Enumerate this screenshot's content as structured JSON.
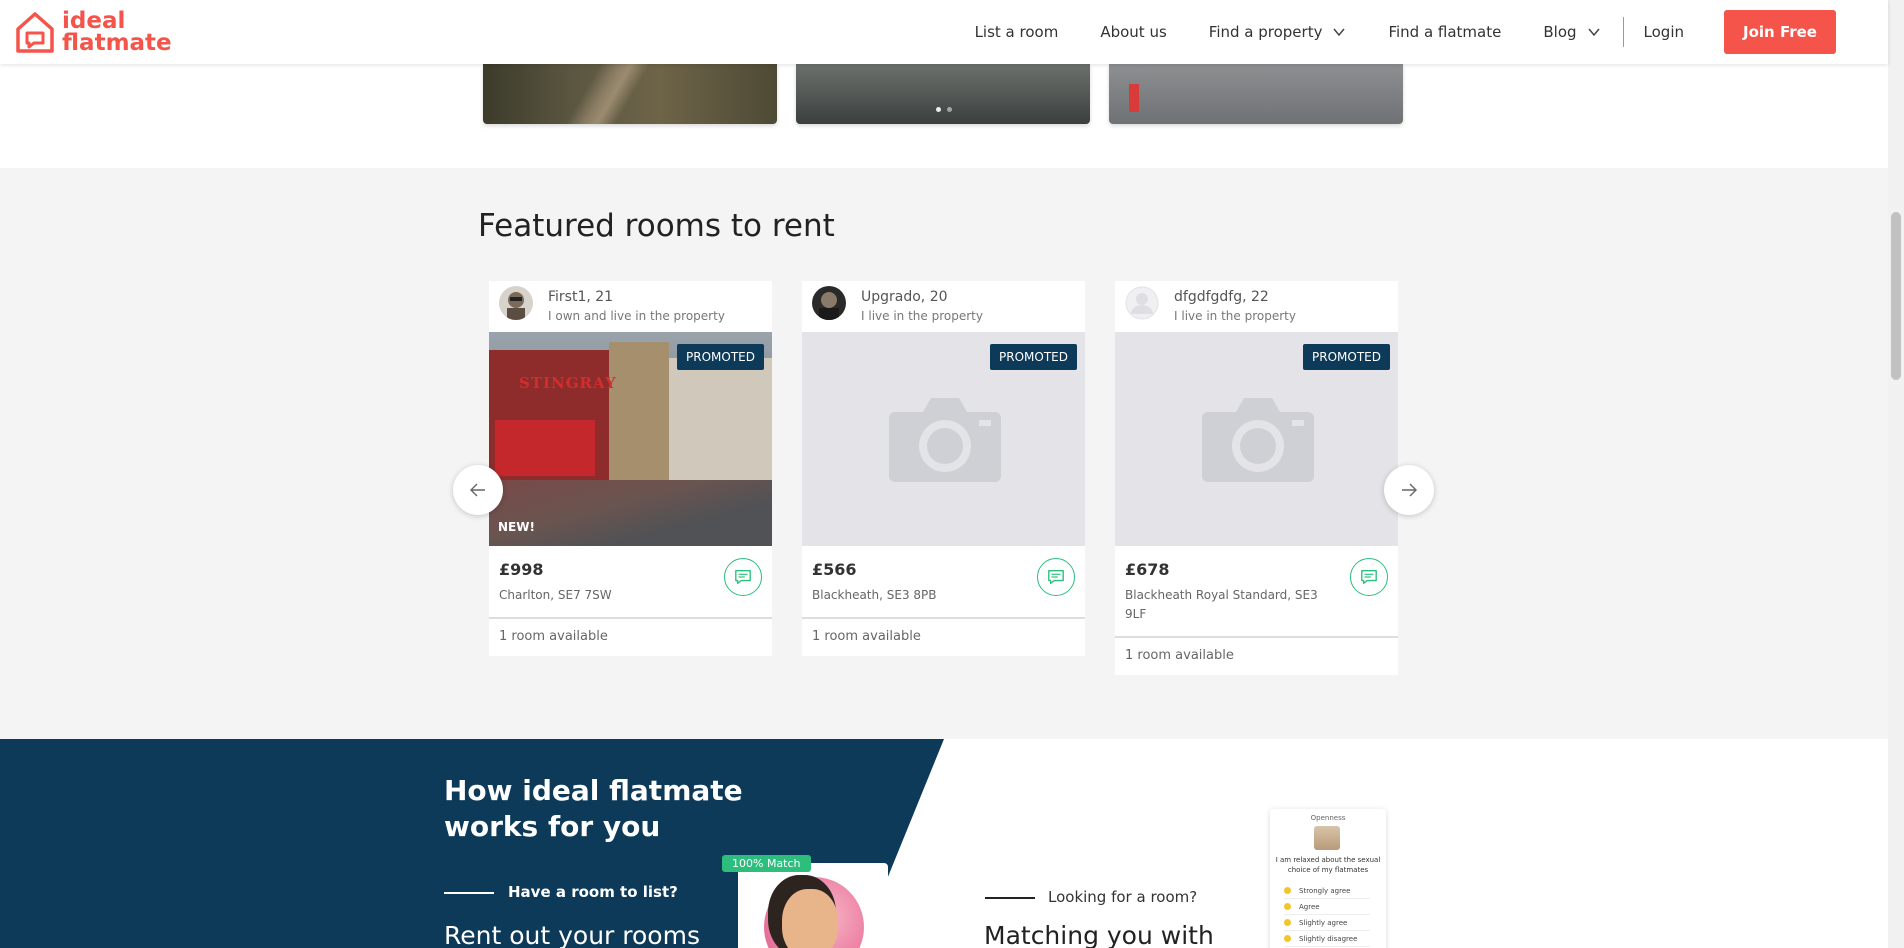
{
  "header": {
    "logo_line1": "ideal",
    "logo_line2": "flatmate",
    "nav": [
      {
        "label": "List a room"
      },
      {
        "label": "About us"
      },
      {
        "label": "Find a property",
        "dropdown": true
      },
      {
        "label": "Find a flatmate"
      },
      {
        "label": "Blog",
        "dropdown": true
      }
    ],
    "login": "Login",
    "join": "Join Free",
    "brand_color": "#f4544a"
  },
  "featured": {
    "title": "Featured rooms to rent",
    "cards": [
      {
        "owner": "First1, 21",
        "status": "I own and live in the property",
        "badge": "PROMOTED",
        "new_label": "NEW!",
        "price": "£998",
        "address": "Charlton, SE7 7SW",
        "availability": "1 room available"
      },
      {
        "owner": "Upgrado, 20",
        "status": "I live in the property",
        "badge": "PROMOTED",
        "price": "£566",
        "address": "Blackheath, SE3 8PB",
        "availability": "1 room available"
      },
      {
        "owner": "dfgdfgdfg, 22",
        "status": "I live in the property",
        "badge": "PROMOTED",
        "price": "£678",
        "address": "Blackheath Royal Standard, SE3 9LF",
        "availability": "1 room available"
      }
    ],
    "street_sign": "STINGRAY"
  },
  "how": {
    "title_line1": "How ideal flatmate",
    "title_line2": "works for you",
    "have_room": "Have a room to list?",
    "rent_out": "Rent out your rooms",
    "match_badge": "100% Match",
    "looking": "Looking for a room?",
    "matching": "Matching you with",
    "quiz": {
      "category": "Openness",
      "question": "I am relaxed about the sexual choice of my flatmates",
      "options": [
        "Strongly agree",
        "Agree",
        "Slightly agree",
        "Slightly disagree"
      ]
    },
    "navy_color": "#0d3a58",
    "accent_green": "#2dbe7d"
  }
}
